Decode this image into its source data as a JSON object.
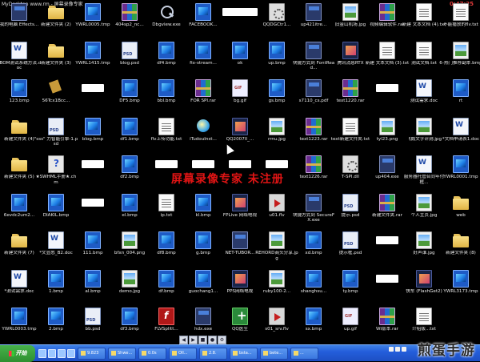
{
  "window": {
    "top_text": "MyDesktop www.rm - 屏幕录像专家",
    "time": "0:47:25",
    "recorder_banner": "屏幕录像专家 未注册"
  },
  "desktop": {
    "icons": [
      {
        "label": "我的电脑 Effects...",
        "type": "exe"
      },
      {
        "label": "新建文件夹 (2)",
        "type": "folder"
      },
      {
        "label": "YWRL0005.tmp",
        "type": "bmp"
      },
      {
        "label": "404sp2_nc...",
        "type": "rar"
      },
      {
        "label": "Dbgview.exe",
        "type": "tool"
      },
      {
        "label": "FACEBOOK...",
        "type": "bmp"
      },
      {
        "label": "",
        "type": "blank"
      },
      {
        "label": "QQDGCtr1...",
        "type": "dll"
      },
      {
        "label": "up421itre...",
        "type": "exe"
      },
      {
        "label": "旧金山机场.jpg",
        "type": "img"
      },
      {
        "label": "视频编辑软件.rar",
        "type": "rar"
      },
      {
        "label": "新建 文本文档 (4).txt",
        "type": "txt"
      },
      {
        "label": "不能播放的flv.txt",
        "type": "txt"
      },
      {
        "label": "*BOM测试系统方法.doc",
        "type": "doc"
      },
      {
        "label": "新建文件夹 (3)",
        "type": "folder"
      },
      {
        "label": "YWRL1415.tmp",
        "type": "bmp"
      },
      {
        "label": "blog.psd",
        "type": "psd"
      },
      {
        "label": "df4.bmp",
        "type": "bmp"
      },
      {
        "label": "fix-stream...",
        "type": "bmp"
      },
      {
        "label": "ok",
        "type": "bmp"
      },
      {
        "label": "up.bmp",
        "type": "bmp"
      },
      {
        "label": "块捷方式到 FontRead...",
        "type": "exe"
      },
      {
        "label": "腾讯消息RTX",
        "type": "app"
      },
      {
        "label": "新建 文本文档 (3).txt",
        "type": "txt"
      },
      {
        "label": "测试文档.txt",
        "type": "txt"
      },
      {
        "label": "6-热门推荐副本.bmp",
        "type": "img"
      },
      {
        "label": "123.bmp",
        "type": "bmp"
      },
      {
        "label": "56Tcx1Bcc...",
        "type": "mgr"
      },
      {
        "label": "",
        "type": "hidden"
      },
      {
        "label": "DF5.bmp",
        "type": "bmp"
      },
      {
        "label": "bbl.bmp",
        "type": "bmp"
      },
      {
        "label": "FOR SPI.rar",
        "type": "rar"
      },
      {
        "label": "bg.gif",
        "type": "gif"
      },
      {
        "label": "gs.bmp",
        "type": "bmp"
      },
      {
        "label": "s7110_cs.pdf",
        "type": "exe"
      },
      {
        "label": "text1220.rar",
        "type": "rar"
      },
      {
        "label": "",
        "type": "hidden"
      },
      {
        "label": "测试需求.doc",
        "type": "doc"
      },
      {
        "label": "rt",
        "type": "bmp"
      },
      {
        "label": "新建文件夹 (4)",
        "type": "folder"
      },
      {
        "label": "\"sss\" 力智能引擎-1.psd",
        "type": "psd"
      },
      {
        "label": "blog.bmp",
        "type": "bmp"
      },
      {
        "label": "df1.bmp",
        "type": "bmp"
      },
      {
        "label": "flv上传功能.txt",
        "type": "txt"
      },
      {
        "label": "iTudouInst...",
        "type": "ie"
      },
      {
        "label": "QQ2007II_...",
        "type": "app"
      },
      {
        "label": "rrnu.jpg",
        "type": "img"
      },
      {
        "label": "text1223.rar",
        "type": "rar"
      },
      {
        "label": "text新建文件夹.txt",
        "type": "txt"
      },
      {
        "label": "tyl23.png",
        "type": "img"
      },
      {
        "label": "飞鹅文字评测.jpg",
        "type": "img"
      },
      {
        "label": "*文档申请表1.doc",
        "type": "doc"
      },
      {
        "label": "新建文件夹 (5)",
        "type": "folder"
      },
      {
        "label": "★SWHML手册★.chm",
        "type": "chm"
      },
      {
        "label": "",
        "type": "hidden"
      },
      {
        "label": "df2.bmp",
        "type": "bmp"
      },
      {
        "label": "",
        "type": "hidden"
      },
      {
        "label": "",
        "type": "hidden"
      },
      {
        "label": "",
        "type": "hidden"
      },
      {
        "label": "",
        "type": "hidden"
      },
      {
        "label": "text1226.rar",
        "type": "rar"
      },
      {
        "label": "T-SPI.dll",
        "type": "dll"
      },
      {
        "label": "up404.exe",
        "type": "exe"
      },
      {
        "label": "服务器托管合同年付框...",
        "type": "doc"
      },
      {
        "label": "YWRL0001.tmp",
        "type": "bmp"
      },
      {
        "label": "6evdc2um2...",
        "type": "bmp"
      },
      {
        "label": "DIAKIL.bmp",
        "type": "bmp"
      },
      {
        "label": "",
        "type": "hidden"
      },
      {
        "label": "el.bmp",
        "type": "bmp"
      },
      {
        "label": "ip.txt",
        "type": "txt"
      },
      {
        "label": "kl.bmp",
        "type": "bmp"
      },
      {
        "label": "FPLive 网络电视",
        "type": "app"
      },
      {
        "label": "u01.flv",
        "type": "flv"
      },
      {
        "label": "块捷方式到 SecureFX.exe",
        "type": "exe"
      },
      {
        "label": "提示.psd",
        "type": "psd"
      },
      {
        "label": "新建文件夹.rar",
        "type": "rar"
      },
      {
        "label": "个人主页.jpg",
        "type": "img"
      },
      {
        "label": "web",
        "type": "folder"
      },
      {
        "label": "新建文件夹 (7)",
        "type": "folder"
      },
      {
        "label": "*文显悉_B2.doc",
        "type": "doc"
      },
      {
        "label": "111.bmp",
        "type": "bmp"
      },
      {
        "label": "bfxn_004.png",
        "type": "img"
      },
      {
        "label": "df8.bmp",
        "type": "bmp"
      },
      {
        "label": "g.bmp",
        "type": "bmp"
      },
      {
        "label": "NET-TUBOR...",
        "type": "exe"
      },
      {
        "label": "REHORD商头分享.jpg",
        "type": "img"
      },
      {
        "label": "xd.bmp",
        "type": "bmp"
      },
      {
        "label": "提示框.psd",
        "type": "psd"
      },
      {
        "label": "",
        "type": "hidden"
      },
      {
        "label": "好声谁.jpg",
        "type": "img"
      },
      {
        "label": "新建文件夹 (8)",
        "type": "folder"
      },
      {
        "label": "*测试需求.doc",
        "type": "doc"
      },
      {
        "label": "1.bmp",
        "type": "bmp"
      },
      {
        "label": "al.bmp",
        "type": "bmp"
      },
      {
        "label": "demo.jpg",
        "type": "img"
      },
      {
        "label": "df.bmp",
        "type": "bmp"
      },
      {
        "label": "guochang1...",
        "type": "bmp"
      },
      {
        "label": "PPS网络电视",
        "type": "app"
      },
      {
        "label": "ruby100-2...",
        "type": "img"
      },
      {
        "label": "shanghsu...",
        "type": "bmp"
      },
      {
        "label": "ty.bmp",
        "type": "bmp"
      },
      {
        "label": "",
        "type": "hidden"
      },
      {
        "label": "快车 (FlashGet2)",
        "type": "app"
      },
      {
        "label": "YWRL3173.tmp",
        "type": "bmp"
      },
      {
        "label": "YWRL0003.tmp",
        "type": "bmp"
      },
      {
        "label": "2.bmp",
        "type": "bmp"
      },
      {
        "label": "bb.psd",
        "type": "psd"
      },
      {
        "label": "df3.bmp",
        "type": "bmp"
      },
      {
        "label": "FLVSplitt...",
        "type": "swf"
      },
      {
        "label": "hdx.exe",
        "type": "exe"
      },
      {
        "label": "QQ医生",
        "type": "sec"
      },
      {
        "label": "s01_srv.flv",
        "type": "flv"
      },
      {
        "label": "sx.bmp",
        "type": "bmp"
      },
      {
        "label": "up.gif",
        "type": "gif"
      },
      {
        "label": "Wi版本.rar",
        "type": "rar"
      },
      {
        "label": "介绍版...txt",
        "type": "txt"
      }
    ]
  },
  "taskbar": {
    "start_label": "开始",
    "buttons": [
      {
        "label": "9.823"
      },
      {
        "label": "Shwe..."
      },
      {
        "label": "0.0s"
      },
      {
        "label": "Oll..."
      },
      {
        "label": "2.8."
      },
      {
        "label": "bsta..."
      },
      {
        "label": "bete..."
      },
      {
        "label": "..."
      }
    ],
    "media_controls": [
      "◀",
      "▶",
      "■",
      "●",
      "⚙"
    ],
    "site_watermark": "煎蛋手游"
  }
}
